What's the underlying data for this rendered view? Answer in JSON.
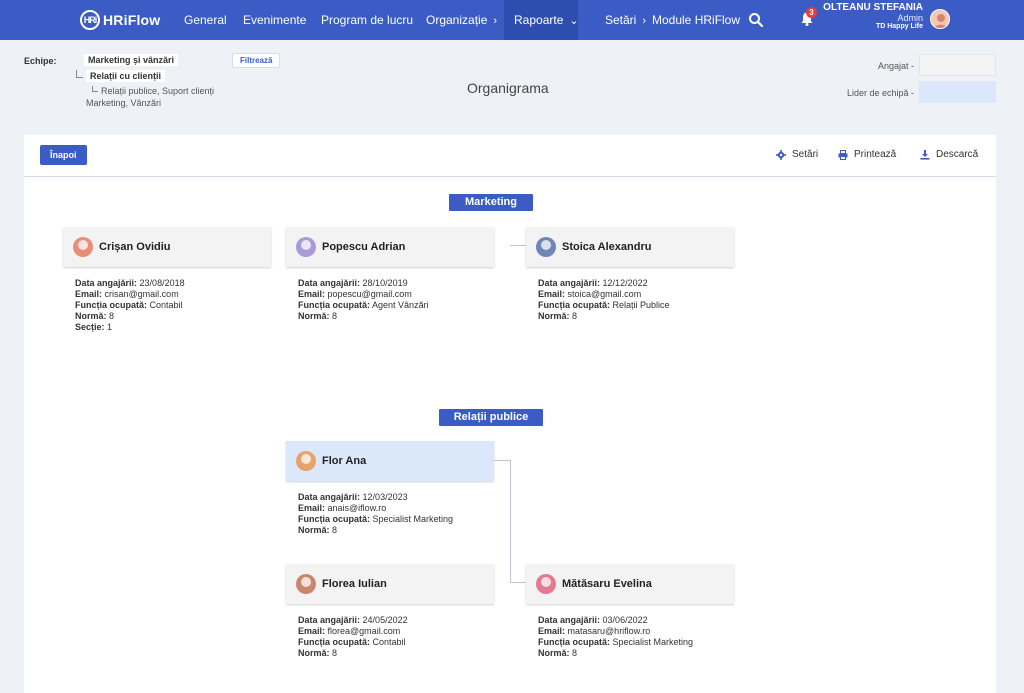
{
  "nav": {
    "logo": "HRiFlow",
    "logo_mark": "HRi",
    "items": [
      {
        "label": "General"
      },
      {
        "label": "Evenimente"
      },
      {
        "label": "Program de lucru"
      },
      {
        "label": "Organizație",
        "chevron": "›"
      },
      {
        "label": "Rapoarte",
        "chevron": "⌄"
      },
      {
        "label": "Setări",
        "chevron": "›"
      },
      {
        "label": "Module HRiFlow"
      }
    ],
    "notifications": "3",
    "user": {
      "name": "OLTEANU STEFANIA",
      "role": "Admin",
      "company": "TD Happy Life"
    }
  },
  "filters": {
    "teams_label": "Echipe:",
    "team": "Marketing și vânzări",
    "sub_team": "Relații cu clienții",
    "sub_sub_team": "Relații publice, Suport clienți",
    "other": "Marketing, Vânzări",
    "filter_button": "Filtrează",
    "legend_employee": "Angajat  -",
    "legend_leader": "Lider de echipă  -"
  },
  "page_title": "Organigrama",
  "toolbar": {
    "back": "Înapoi",
    "settings": "Setări",
    "print": "Printează",
    "download": "Descarcă"
  },
  "labels": {
    "hire_date": "Data angajării:",
    "email": "Email:",
    "position": "Funcția ocupată:",
    "norm": "Normă:",
    "section": "Secție:"
  },
  "sections": [
    {
      "name": "Marketing",
      "people": [
        {
          "name": "Crișan Ovidiu",
          "hire_date": "23/08/2018",
          "email": "crisan@gmail.com",
          "position": "Contabil",
          "norm": "8",
          "section": "1",
          "avatar_color": "#e98d7a"
        },
        {
          "name": "Popescu Adrian",
          "hire_date": "28/10/2019",
          "email": "popescu@gmail.com",
          "position": "Agent Vânzări",
          "norm": "8",
          "avatar_color": "#a99adb"
        },
        {
          "name": "Stoica Alexandru",
          "hire_date": "12/12/2022",
          "email": "stoica@gmail.com",
          "position": "Relații Publice",
          "norm": "8",
          "avatar_color": "#6e86b8"
        }
      ]
    },
    {
      "name": "Relații publice",
      "people": [
        {
          "name": "Flor Ana",
          "hire_date": "12/03/2023",
          "email": "anais@iflow.ro",
          "position": "Specialist Marketing",
          "norm": "8",
          "avatar_color": "#e8a26b"
        },
        {
          "name": "Florea Iulian",
          "hire_date": "24/05/2022",
          "email": "florea@gmail.com",
          "position": "Contabil",
          "norm": "8",
          "avatar_color": "#c9876d"
        },
        {
          "name": "Mătăsaru Evelina",
          "hire_date": "03/06/2022",
          "email": "matasaru@hriflow.ro",
          "position": "Specialist Marketing",
          "norm": "8",
          "avatar_color": "#e37a92"
        }
      ]
    }
  ],
  "colors": {
    "primary": "#3a5cc4",
    "leader_highlight": "#dbe8fb",
    "background": "#eef1f6"
  }
}
